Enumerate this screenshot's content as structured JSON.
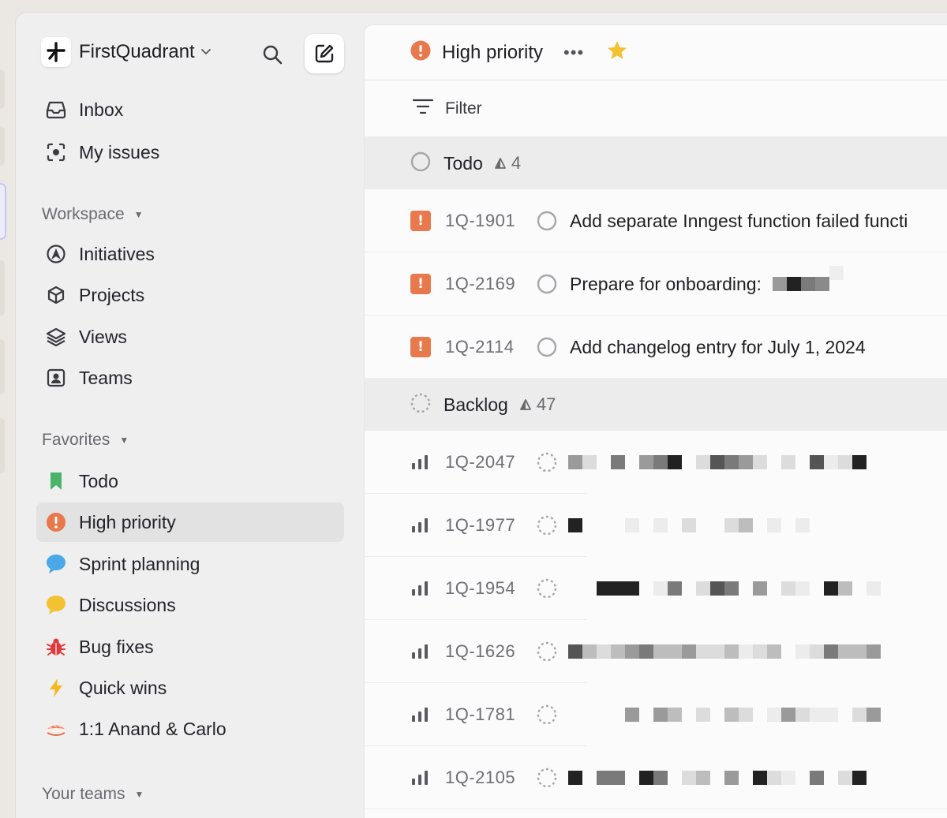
{
  "workspace": {
    "name": "FirstQuadrant"
  },
  "sidebar": {
    "top_items": [
      {
        "label": "Inbox",
        "icon": "inbox-icon"
      },
      {
        "label": "My issues",
        "icon": "my-issues-icon"
      }
    ],
    "workspace_section": {
      "title": "Workspace",
      "items": [
        {
          "label": "Initiatives",
          "icon": "initiatives-icon"
        },
        {
          "label": "Projects",
          "icon": "projects-icon"
        },
        {
          "label": "Views",
          "icon": "views-icon"
        },
        {
          "label": "Teams",
          "icon": "teams-icon"
        }
      ]
    },
    "favorites_section": {
      "title": "Favorites",
      "items": [
        {
          "label": "Todo",
          "icon": "bookmark-icon",
          "color": "#4cb36a"
        },
        {
          "label": "High priority",
          "icon": "high-priority-icon",
          "color": "#e8794c",
          "active": true
        },
        {
          "label": "Sprint planning",
          "icon": "chat-bubble-icon",
          "color": "#4aa8e8"
        },
        {
          "label": "Discussions",
          "icon": "chat-bubble-icon",
          "color": "#f2c230"
        },
        {
          "label": "Bug fixes",
          "icon": "bug-icon",
          "color": "#e0393e"
        },
        {
          "label": "Quick wins",
          "icon": "lightning-icon",
          "color": "#f5b719"
        },
        {
          "label": "1:1 Anand & Carlo",
          "icon": "sushi-icon"
        }
      ]
    },
    "teams_section": {
      "title": "Your teams"
    }
  },
  "main": {
    "header": {
      "title": "High priority",
      "more": "•••"
    },
    "filter": {
      "label": "Filter"
    },
    "groups": [
      {
        "name": "Todo",
        "count": "4",
        "status": "todo",
        "issues": [
          {
            "id": "1Q-1901",
            "title": "Add separate Inngest function failed functi"
          },
          {
            "id": "1Q-2169",
            "title": "Prepare for onboarding:"
          },
          {
            "id": "1Q-2114",
            "title": "Add changelog entry for July 1, 2024"
          }
        ]
      },
      {
        "name": "Backlog",
        "count": "47",
        "status": "backlog",
        "issues": [
          {
            "id": "1Q-2047"
          },
          {
            "id": "1Q-1977"
          },
          {
            "id": "1Q-1954"
          },
          {
            "id": "1Q-1626"
          },
          {
            "id": "1Q-1781"
          },
          {
            "id": "1Q-2105"
          }
        ]
      }
    ]
  },
  "colors": {
    "accent_orange": "#e8794c",
    "star": "#f2c230",
    "sidebar_bg": "#efefef",
    "main_bg": "#fbfbfb"
  }
}
